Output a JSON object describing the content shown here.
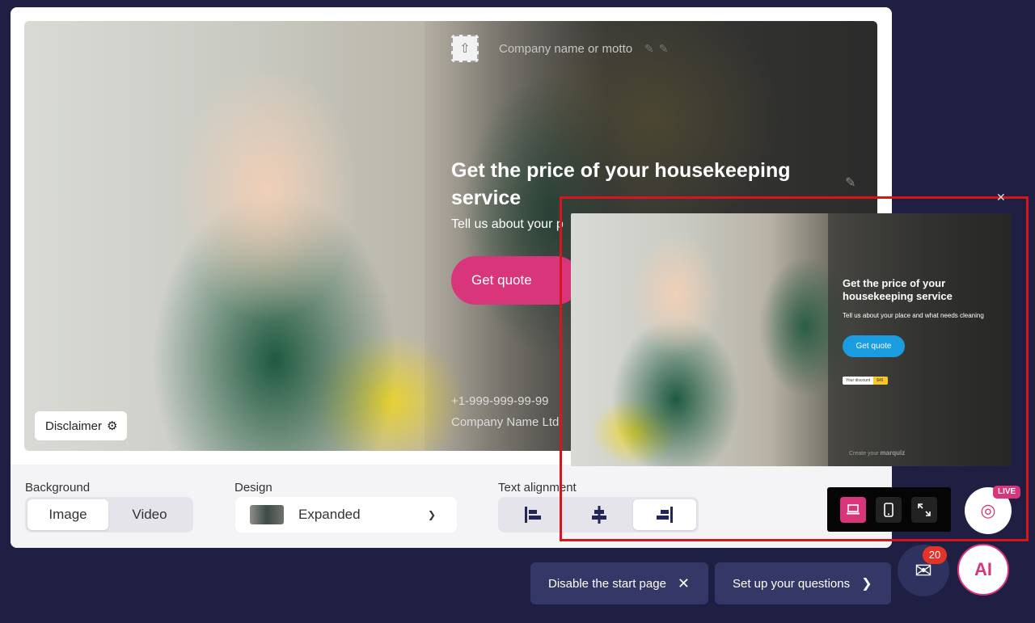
{
  "stage": {
    "motto_placeholder": "Company name or motto",
    "headline": "Get the price of your housekeeping service",
    "subline": "Tell us about your p",
    "quote_button": "Get quote",
    "phone": "+1-999-999-99-99",
    "company": "Company Name Ltd",
    "disclaimer": "Disclaimer"
  },
  "controls": {
    "background_label": "Background",
    "background_options": [
      "Image",
      "Video"
    ],
    "background_selected": "Image",
    "design_label": "Design",
    "design_value": "Expanded",
    "alignment_label": "Text alignment"
  },
  "preview": {
    "headline": "Get the price of your housekeeping service",
    "subline": "Tell us about your place and what needs cleaning",
    "quote_button": "Get quote",
    "discount_label": "Your discount",
    "discount_value": "$45",
    "credit_text": "Create your",
    "credit_brand": "marquiz"
  },
  "live_badge": "LIVE",
  "bottom": {
    "disable_label": "Disable the start page",
    "setup_label": "Set up your questions"
  },
  "chat_count": "20",
  "ai_label": "AI",
  "colors": {
    "accent": "#d9357a",
    "background": "#1e1f43",
    "highlight_frame": "#d8141d",
    "preview_button": "#1a9de0"
  }
}
